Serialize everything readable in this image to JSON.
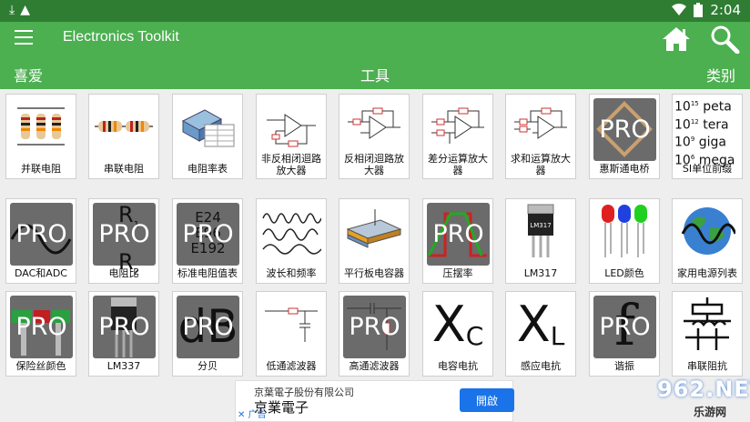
{
  "status": {
    "time": "2:04"
  },
  "app": {
    "title": "Electronics Toolkit"
  },
  "tabs": [
    {
      "label": "喜爱"
    },
    {
      "label": "工具"
    },
    {
      "label": "类别"
    }
  ],
  "pro_badge": "PRO",
  "tiles": [
    {
      "label": "并联电阻",
      "pro": false
    },
    {
      "label": "串联电阻",
      "pro": false
    },
    {
      "label": "电阻率表",
      "pro": false
    },
    {
      "label": "非反相闭迴路放大器",
      "pro": false
    },
    {
      "label": "反相闭迴路放大器",
      "pro": false
    },
    {
      "label": "差分运算放大器",
      "pro": false
    },
    {
      "label": "求和运算放大器",
      "pro": false
    },
    {
      "label": "惠斯通电桥",
      "pro": true
    },
    {
      "label": "SI单位前缀",
      "pro": false
    },
    {
      "label": "DAC和ADC",
      "pro": true
    },
    {
      "label": "电阻比",
      "pro": true
    },
    {
      "label": "标准电阻值表",
      "pro": true
    },
    {
      "label": "波长和频率",
      "pro": false
    },
    {
      "label": "平行板电容器",
      "pro": false
    },
    {
      "label": "压摆率",
      "pro": true
    },
    {
      "label": "LM317",
      "pro": false
    },
    {
      "label": "LED颜色",
      "pro": false
    },
    {
      "label": "家用电源列表",
      "pro": false
    },
    {
      "label": "保险丝颜色",
      "pro": true
    },
    {
      "label": "LM337",
      "pro": true
    },
    {
      "label": "分贝",
      "pro": true
    },
    {
      "label": "低通滤波器",
      "pro": false
    },
    {
      "label": "高通滤波器",
      "pro": true
    },
    {
      "label": "电容电抗",
      "pro": false
    },
    {
      "label": "感应电抗",
      "pro": false
    },
    {
      "label": "谐振",
      "pro": true
    },
    {
      "label": "串联阻抗",
      "pro": false
    }
  ],
  "si_prefix": {
    "p1": "peta",
    "p2": "tera",
    "p3": "giga",
    "p4": "mega",
    "e1": "15",
    "e2": "12",
    "e3": "9",
    "e4": "6",
    "base": "10"
  },
  "ratio": {
    "r1": "R",
    "s1": "1",
    "r2": "R",
    "s2": "2"
  },
  "std_values": {
    "a": "E24",
    "b": "E96",
    "c": "E192"
  },
  "chip_labels": {
    "lm317": "LM317",
    "lm337": "LM337",
    "db": "dB",
    "x": "X",
    "c": "C",
    "l": "L",
    "f": "f"
  },
  "ad": {
    "company": "京葉電子股份有限公司",
    "brand": "京業電子",
    "button": "開啟",
    "tag": "广告"
  },
  "watermark": {
    "big": "962.NET",
    "small": "乐游网"
  },
  "colors": {
    "primary": "#4caf50",
    "statusbar": "#2e7d32",
    "pro": "#6b6b6b"
  }
}
